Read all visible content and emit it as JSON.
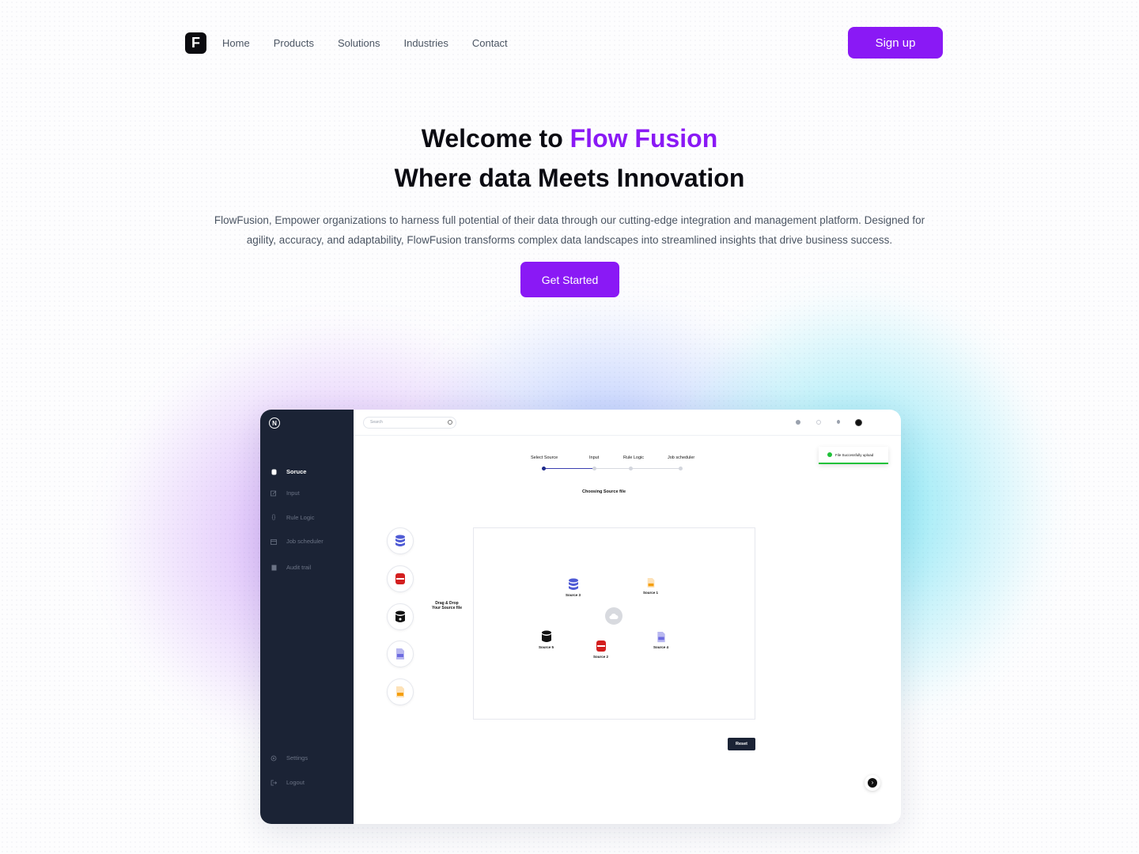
{
  "nav": {
    "logo": "F",
    "links": [
      "Home",
      "Products",
      "Solutions",
      "Industries",
      "Contact"
    ],
    "signup_label": "Sign up"
  },
  "hero": {
    "title_prefix": "Welcome to ",
    "title_brand": "Flow Fusion",
    "subtitle": "Where data Meets Innovation",
    "description": "FlowFusion, Empower organizations to harness full potential of their data through our cutting-edge integration and management platform. Designed for agility, accuracy, and adaptability, FlowFusion transforms complex data landscapes into streamlined insights that drive business success.",
    "cta_label": "Get Started"
  },
  "app": {
    "logo": "N",
    "sidebar": {
      "items": [
        "Soruce",
        "Input",
        "Rule Logic",
        "Job scheduler",
        "Audit trail"
      ],
      "bottom": [
        "Settings",
        "Logout"
      ]
    },
    "search_placeholder": "Search",
    "steps": [
      "Select Source",
      "Input",
      "Rule Logic",
      "Job scheduler"
    ],
    "current_step": 1,
    "toast": "File Successfully upload",
    "choosing_label": "Choosing Source file",
    "drag_label_1": "Drag & Drop",
    "drag_label_2": "Your Source file",
    "sources": [
      "Source 3",
      "Source 1",
      "Source 5",
      "Source 2",
      "Source 4"
    ],
    "reset_label": "Reset"
  },
  "colors": {
    "accent": "#8a19f5",
    "sidebar": "#1b2335",
    "success": "#1fc139"
  }
}
